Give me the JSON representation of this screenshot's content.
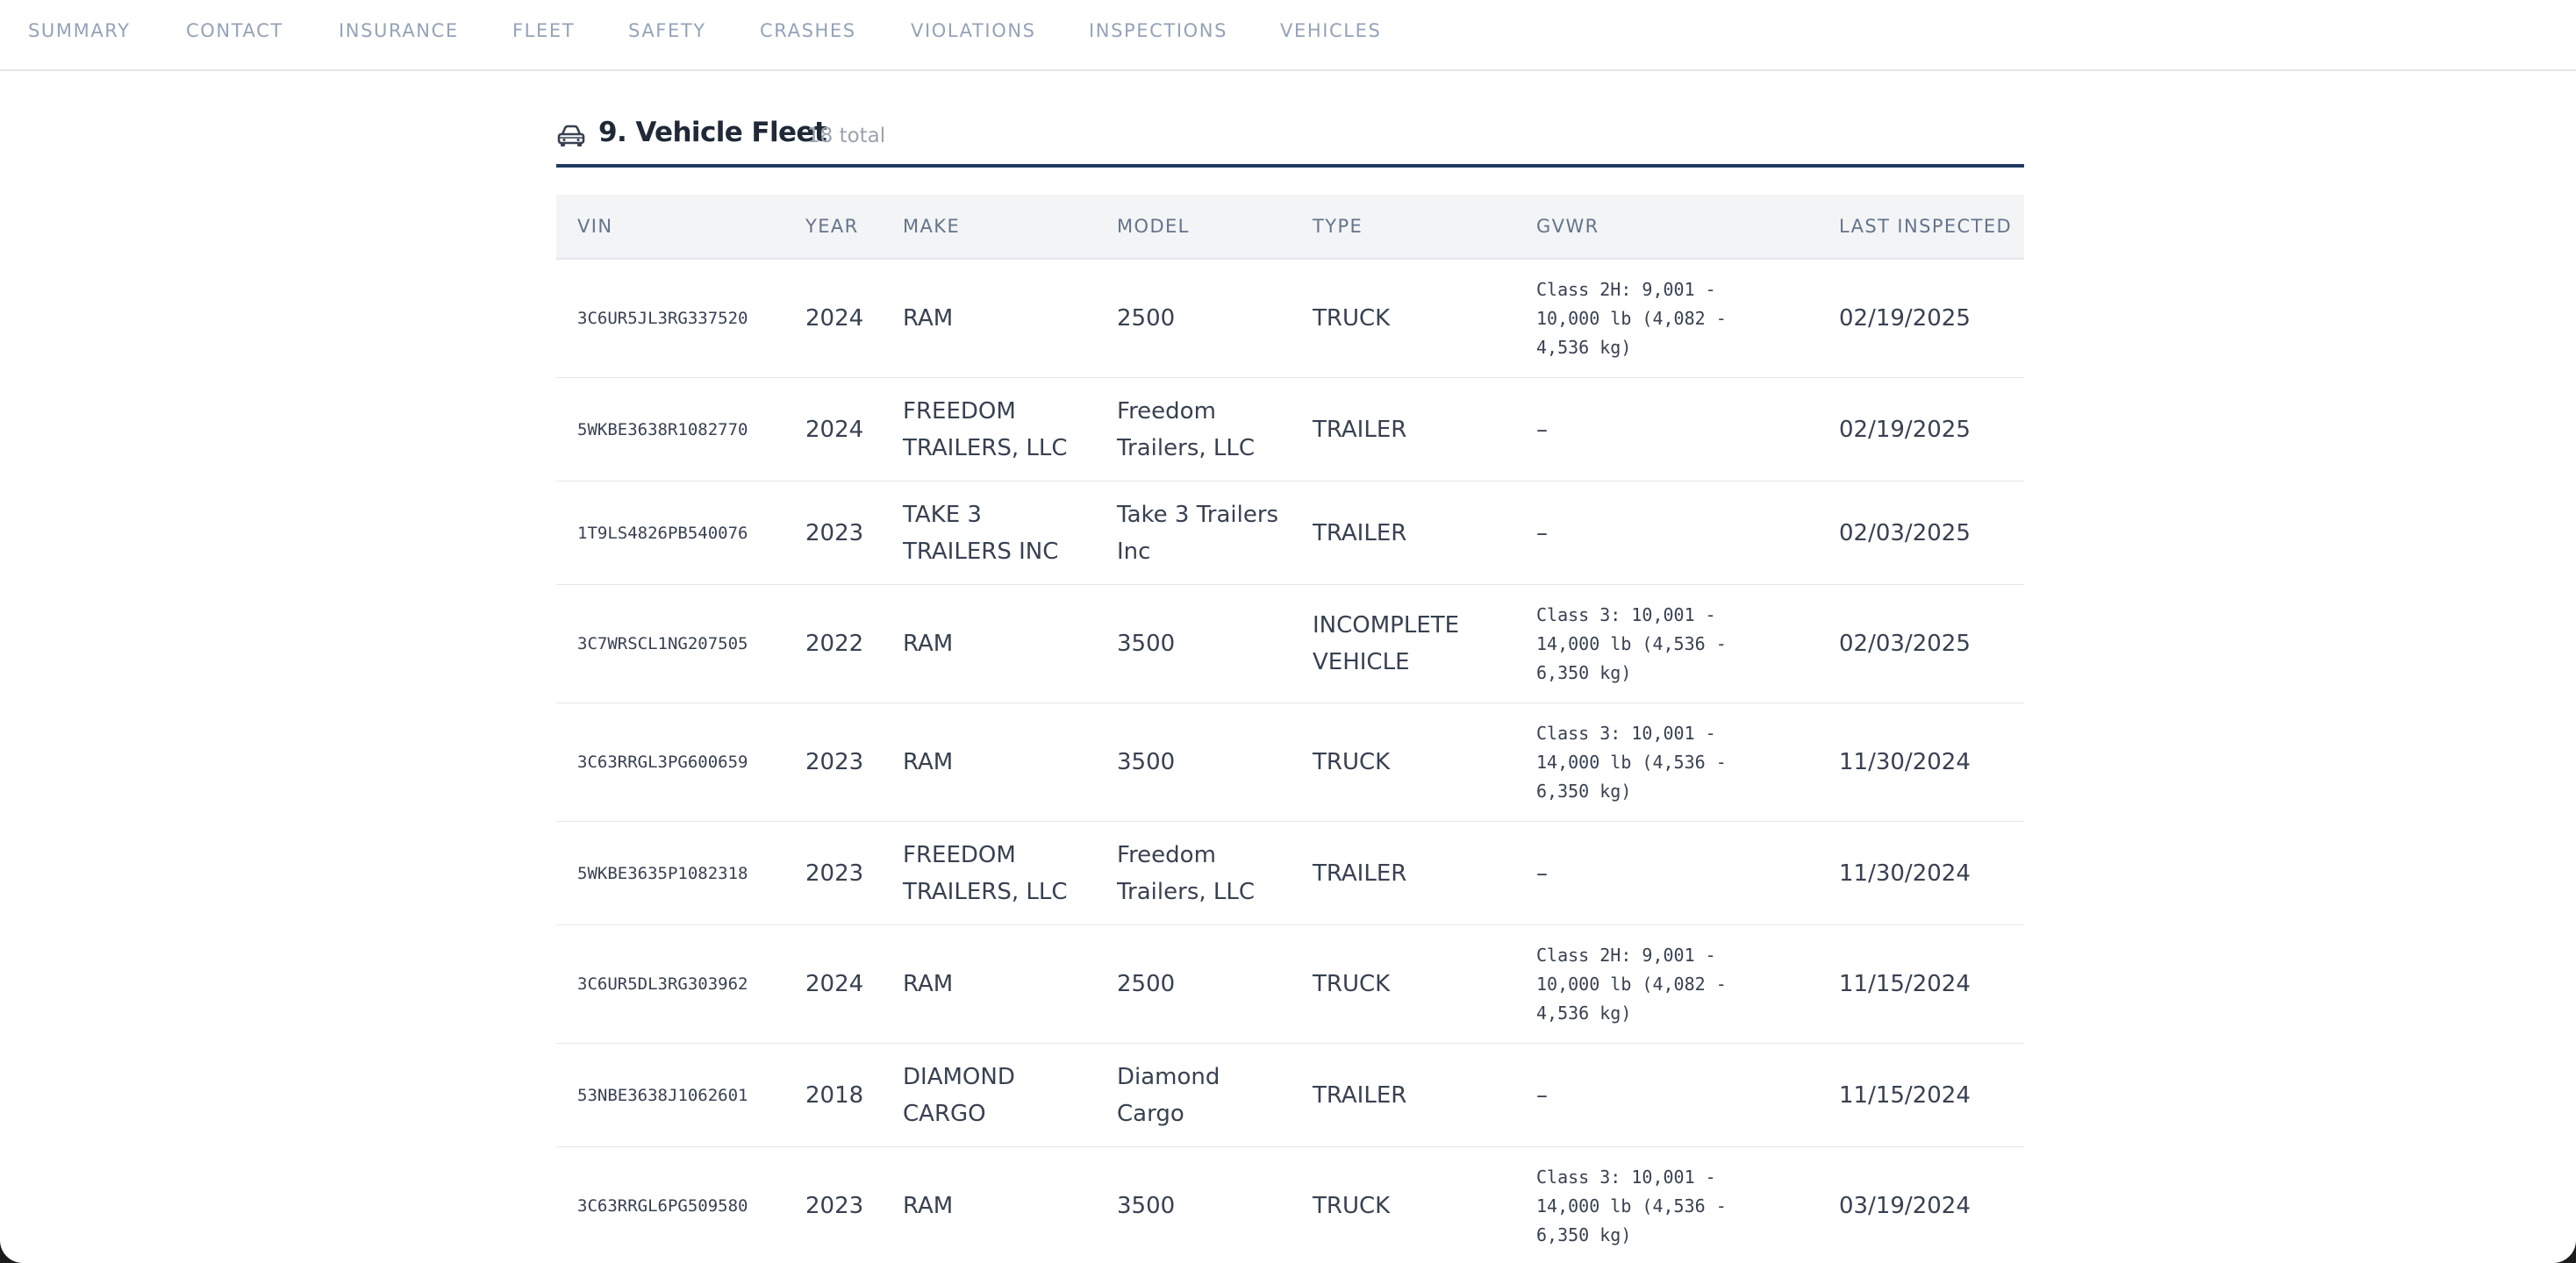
{
  "nav": {
    "items": [
      "SUMMARY",
      "CONTACT",
      "INSURANCE",
      "FLEET",
      "SAFETY",
      "CRASHES",
      "VIOLATIONS",
      "INSPECTIONS",
      "VEHICLES"
    ]
  },
  "section": {
    "icon": "car-icon",
    "title": "9. Vehicle Fleet",
    "count": "18 total"
  },
  "table": {
    "columns": [
      "VIN",
      "YEAR",
      "MAKE",
      "MODEL",
      "TYPE",
      "GVWR",
      "LAST INSPECTED"
    ],
    "rows": [
      {
        "vin": "3C6UR5JL3RG337520",
        "year": "2024",
        "make": "RAM",
        "model": "2500",
        "type": "TRUCK",
        "gvwr": "Class 2H: 9,001 - 10,000 lb (4,082 - 4,536 kg)",
        "last": "02/19/2025"
      },
      {
        "vin": "5WKBE3638R1082770",
        "year": "2024",
        "make": "FREEDOM TRAILERS, LLC",
        "model": "Freedom Trailers, LLC",
        "type": "TRAILER",
        "gvwr": "–",
        "last": "02/19/2025"
      },
      {
        "vin": "1T9LS4826PB540076",
        "year": "2023",
        "make": "TAKE 3 TRAILERS INC",
        "model": "Take 3 Trailers Inc",
        "type": "TRAILER",
        "gvwr": "–",
        "last": "02/03/2025"
      },
      {
        "vin": "3C7WRSCL1NG207505",
        "year": "2022",
        "make": "RAM",
        "model": "3500",
        "type": "INCOMPLETE VEHICLE",
        "gvwr": "Class 3: 10,001 - 14,000 lb (4,536 - 6,350 kg)",
        "last": "02/03/2025"
      },
      {
        "vin": "3C63RRGL3PG600659",
        "year": "2023",
        "make": "RAM",
        "model": "3500",
        "type": "TRUCK",
        "gvwr": "Class 3: 10,001 - 14,000 lb (4,536 - 6,350 kg)",
        "last": "11/30/2024"
      },
      {
        "vin": "5WKBE3635P1082318",
        "year": "2023",
        "make": "FREEDOM TRAILERS, LLC",
        "model": "Freedom Trailers, LLC",
        "type": "TRAILER",
        "gvwr": "–",
        "last": "11/30/2024"
      },
      {
        "vin": "3C6UR5DL3RG303962",
        "year": "2024",
        "make": "RAM",
        "model": "2500",
        "type": "TRUCK",
        "gvwr": "Class 2H: 9,001 - 10,000 lb (4,082 - 4,536 kg)",
        "last": "11/15/2024"
      },
      {
        "vin": "53NBE3638J1062601",
        "year": "2018",
        "make": "DIAMOND CARGO",
        "model": "Diamond Cargo",
        "type": "TRAILER",
        "gvwr": "–",
        "last": "11/15/2024"
      },
      {
        "vin": "3C63RRGL6PG509580",
        "year": "2023",
        "make": "RAM",
        "model": "3500",
        "type": "TRUCK",
        "gvwr": "Class 3: 10,001 - 14,000 lb (4,536 - 6,350 kg)",
        "last": "03/19/2024"
      }
    ]
  }
}
